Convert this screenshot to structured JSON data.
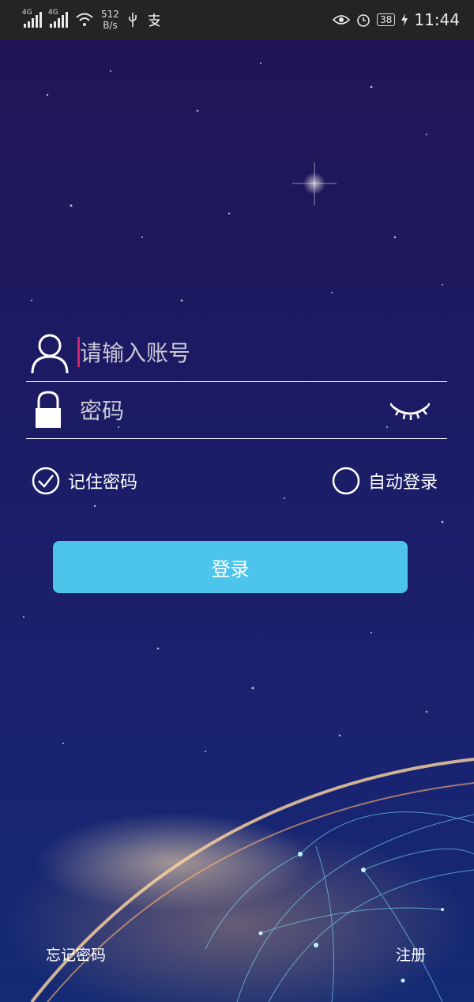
{
  "status_bar": {
    "net_label_1": "4G",
    "net_label_2": "4G",
    "speed_value": "512",
    "speed_unit": "B/s",
    "battery": "38",
    "time": "11:44"
  },
  "login_form": {
    "account_placeholder": "请输入账号",
    "password_placeholder": "密码",
    "remember_label": "记住密码",
    "remember_checked": true,
    "auto_login_label": "自动登录",
    "auto_login_checked": false,
    "login_button": "登录"
  },
  "footer": {
    "forgot_label": "忘记密码",
    "register_label": "注册"
  },
  "icons": {
    "account": "user-icon",
    "password": "lock-icon",
    "toggle": "eye-closed-icon",
    "remember": "check-circle-icon",
    "auto": "circle-icon"
  },
  "colors": {
    "button": "#4dc4ec",
    "caret": "#d6246e",
    "status_bar": "#242424"
  }
}
